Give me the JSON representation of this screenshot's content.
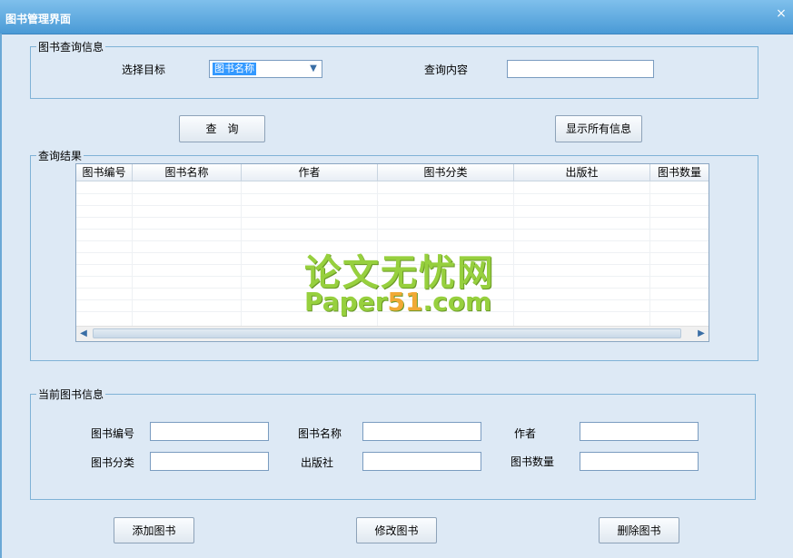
{
  "window": {
    "title": "图书管理界面",
    "close_glyph": "×"
  },
  "query_group": {
    "legend": "图书查询信息",
    "target_label": "选择目标",
    "target_value": "图书名称",
    "content_label": "查询内容",
    "content_value": ""
  },
  "buttons": {
    "query": "查　询",
    "show_all": "显示所有信息",
    "add": "添加图书",
    "edit": "修改图书",
    "delete": "删除图书"
  },
  "results_group": {
    "legend": "查询结果",
    "columns": [
      "图书编号",
      "图书名称",
      "作者",
      "图书分类",
      "出版社",
      "图书数量"
    ],
    "rows": []
  },
  "watermark": {
    "line1": "论文无忧网",
    "line2_a": "Paper",
    "line2_b": "51",
    "line2_c": ".com"
  },
  "current_group": {
    "legend": "当前图书信息",
    "fields": {
      "book_id": {
        "label": "图书编号",
        "value": ""
      },
      "book_name": {
        "label": "图书名称",
        "value": ""
      },
      "author": {
        "label": "作者",
        "value": ""
      },
      "category": {
        "label": "图书分类",
        "value": ""
      },
      "publisher": {
        "label": "出版社",
        "value": ""
      },
      "quantity": {
        "label": "图书数量",
        "value": ""
      }
    }
  },
  "icons": {
    "dropdown": "chevron-down-icon",
    "scroll_left": "arrow-left-icon",
    "scroll_right": "arrow-right-icon",
    "close": "close-icon"
  },
  "colors": {
    "title_bar": "#4a9ad6",
    "background": "#dde9f5",
    "group_border": "#7fb2d6",
    "watermark_green": "#8ccc2a",
    "watermark_orange": "#f0a020"
  }
}
